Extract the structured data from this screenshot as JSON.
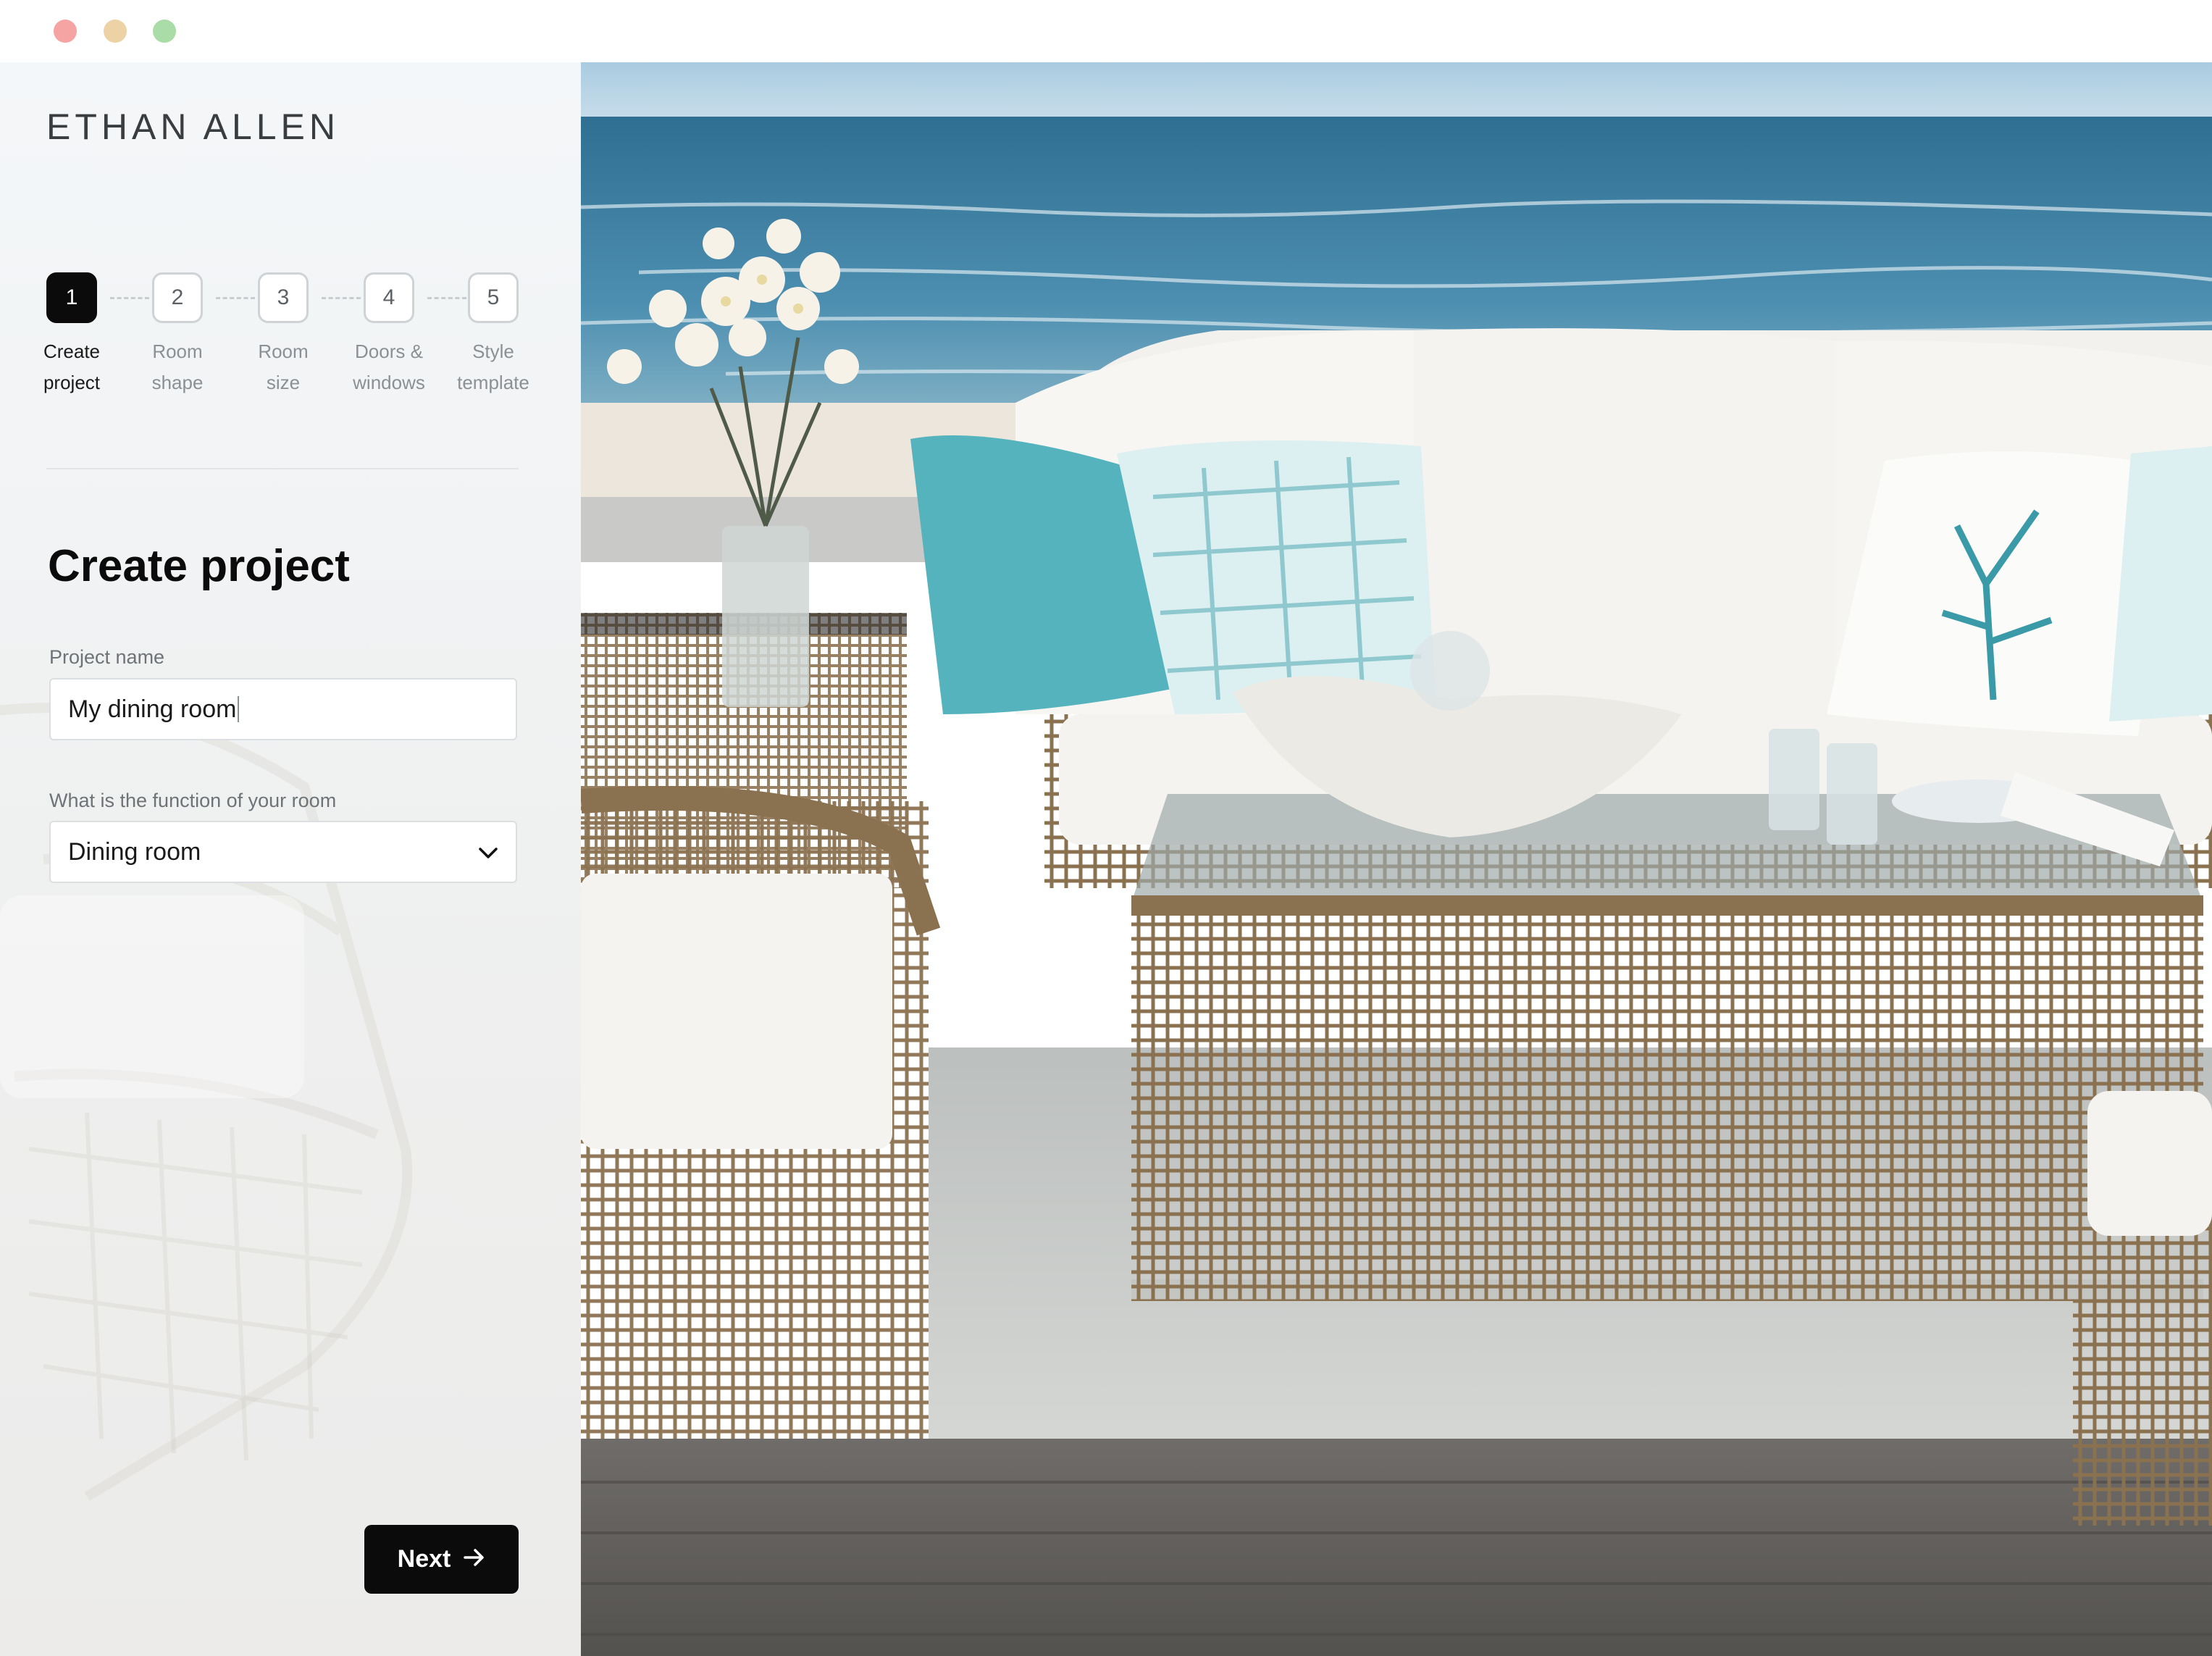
{
  "window": {
    "controls": [
      "close",
      "minimize",
      "maximize"
    ]
  },
  "brand": {
    "logo": "ETHAN ALLEN"
  },
  "stepper": {
    "steps": [
      {
        "number": "1",
        "label_line1": "Create",
        "label_line2": "project",
        "active": true
      },
      {
        "number": "2",
        "label_line1": "Room",
        "label_line2": "shape",
        "active": false
      },
      {
        "number": "3",
        "label_line1": "Room",
        "label_line2": "size",
        "active": false
      },
      {
        "number": "4",
        "label_line1": "Doors &",
        "label_line2": "windows",
        "active": false
      },
      {
        "number": "5",
        "label_line1": "Style",
        "label_line2": "template",
        "active": false
      }
    ]
  },
  "form": {
    "title": "Create project",
    "project_name": {
      "label": "Project name",
      "value": "My dining room"
    },
    "room_function": {
      "label": "What is the function of your room",
      "selected": "Dining room"
    },
    "next_label": "Next"
  },
  "hero": {
    "description_icon": "outdoor-patio-photo"
  },
  "colors": {
    "primary": "#0b0b0b",
    "panel_bg": "#f1f3f4",
    "sea": "#3f86a9",
    "accent_pillow": "#55b3bd"
  }
}
